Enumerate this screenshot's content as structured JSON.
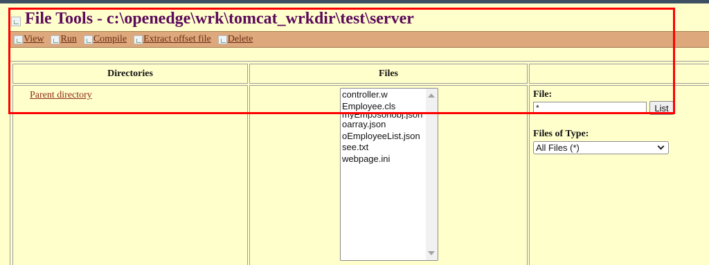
{
  "page": {
    "title": "File Tools - c:\\openedge\\wrk\\tomcat_wrkdir\\test\\server"
  },
  "toolbar": {
    "items": [
      {
        "label": "View",
        "icon": "view-icon"
      },
      {
        "label": "Run",
        "icon": "run-icon"
      },
      {
        "label": "Compile",
        "icon": "compile-icon"
      },
      {
        "label": "Extract offset file",
        "icon": "extract-icon"
      },
      {
        "label": "Delete",
        "icon": "delete-icon"
      }
    ]
  },
  "table": {
    "headers": {
      "directories": "Directories",
      "files": "Files",
      "third": ""
    }
  },
  "directories": {
    "parent_link": "Parent directory"
  },
  "files": {
    "items": [
      "controller.w",
      "Employee.cls",
      "myEmpJsonobj.json",
      "oarray.json",
      "oEmployeeList.json",
      "see.txt",
      "webpage.ini"
    ]
  },
  "filter": {
    "file_label": "File:",
    "file_value": "*",
    "list_button": "List",
    "type_label": "Files of Type:",
    "type_selected": "All Files (*)"
  },
  "colors": {
    "background": "#ffffcc",
    "toolbar": "#dca87c",
    "title": "#5a0a5a",
    "link": "#8b2a12",
    "highlight_frame": "#ff0000"
  }
}
